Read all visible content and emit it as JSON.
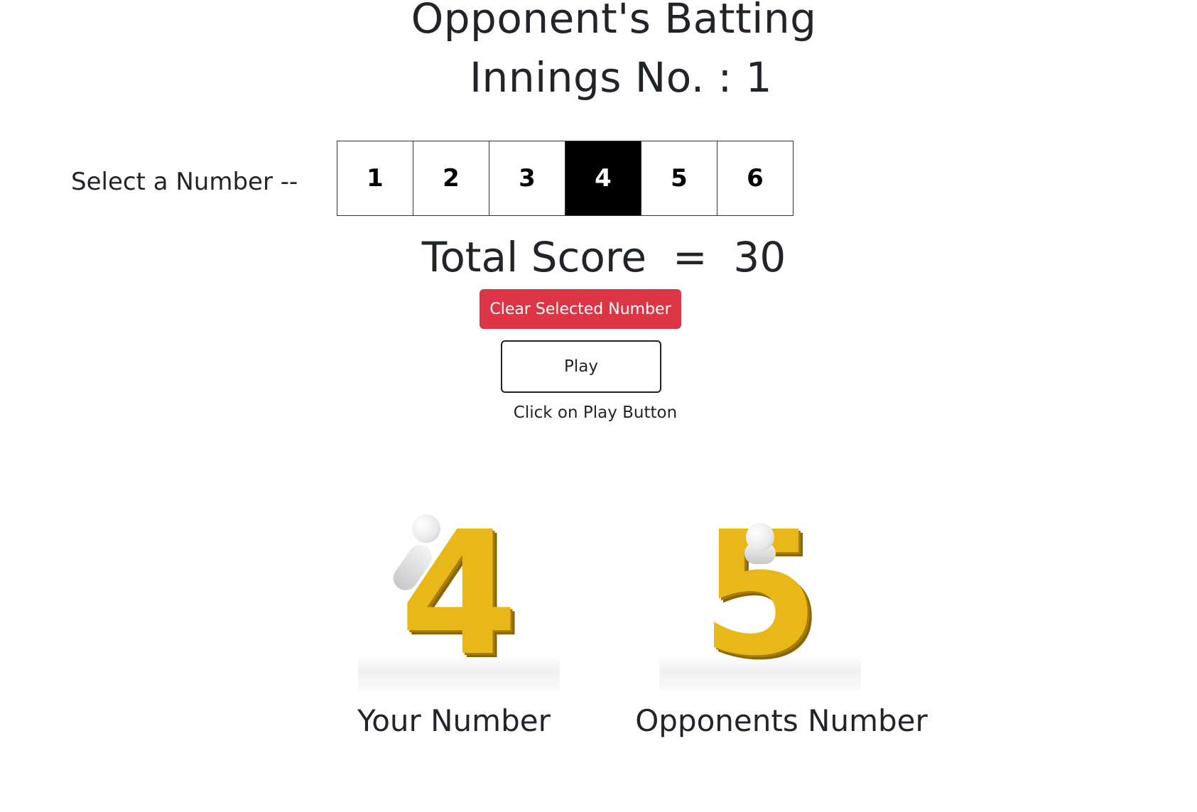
{
  "header": {
    "title": "Opponent's Batting",
    "innings": "Innings No. : 1"
  },
  "selector": {
    "label": "Select a Number --",
    "numbers": [
      "1",
      "2",
      "3",
      "4",
      "5",
      "6"
    ],
    "selected": "4"
  },
  "score": {
    "text": "Total Score  =  30"
  },
  "buttons": {
    "clear_label": "Clear Selected Number",
    "play_label": "Play"
  },
  "hint": "Click on Play Button",
  "results": {
    "your_number": "4",
    "your_caption": "Your Number",
    "opponent_number": "5",
    "opponent_caption": "Opponents Number"
  },
  "colors": {
    "danger": "#dc3545",
    "selected_bg": "#000000",
    "gold": "#e8b819"
  }
}
